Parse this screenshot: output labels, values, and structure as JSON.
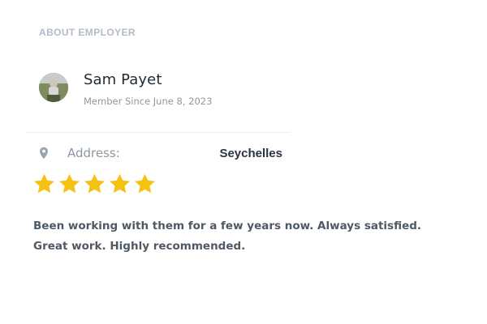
{
  "section": {
    "heading": "ABOUT EMPLOYER"
  },
  "employer": {
    "name": "Sam Payet",
    "member_since": "Member Since June 8, 2023",
    "avatar_icon": "avatar-photo"
  },
  "details": {
    "address_icon": "map-pin-icon",
    "address_label": "Address:",
    "address_value": "Seychelles"
  },
  "rating": {
    "stars": 5,
    "max": 5,
    "icon": "star-icon",
    "color": "#f5c211"
  },
  "review": {
    "text": "Been working with them for a few years now. Always satisfied. Great work. Highly recommended."
  }
}
